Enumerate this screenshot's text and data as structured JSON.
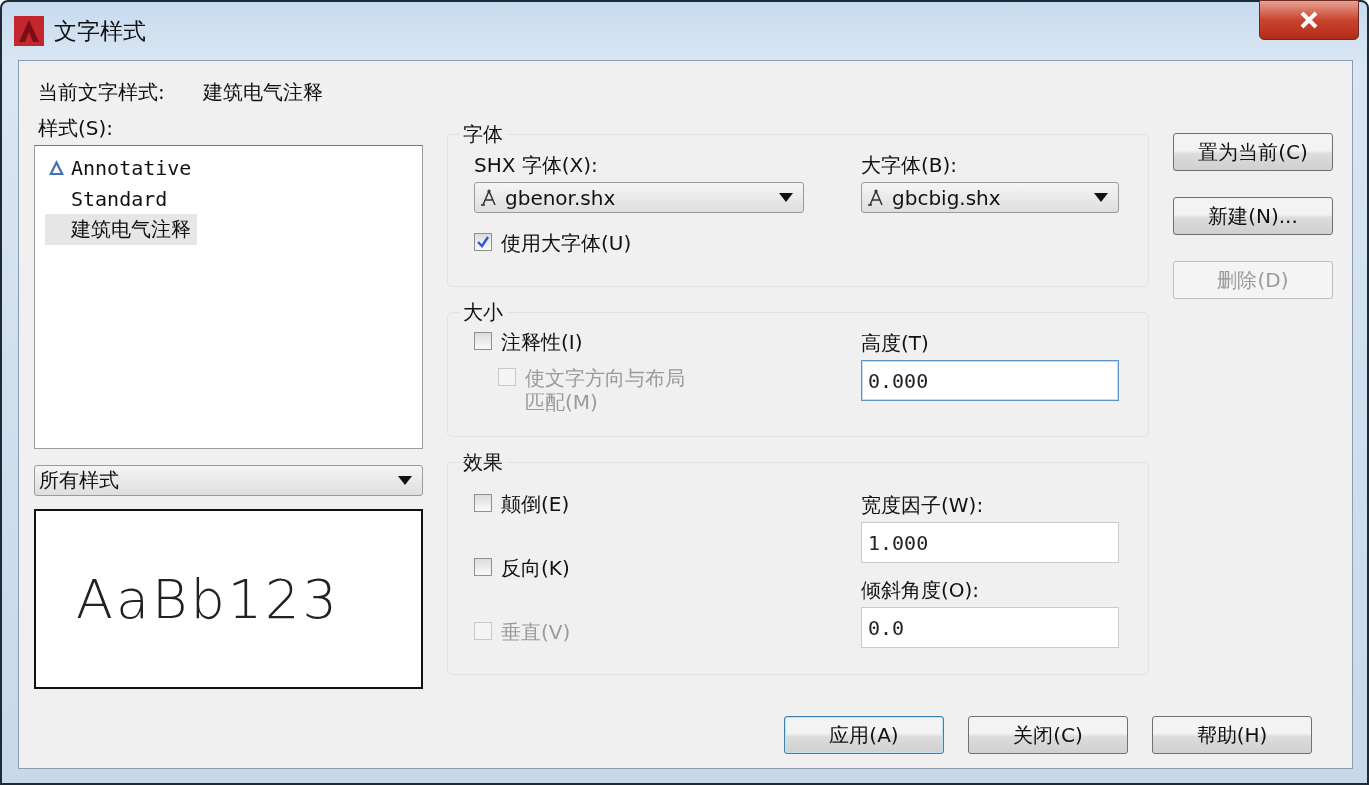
{
  "window": {
    "title": "文字样式"
  },
  "current_style": {
    "label": "当前文字样式:",
    "value": "建筑电气注释"
  },
  "styles": {
    "label": "样式(S):",
    "items": [
      {
        "name": "Annotative",
        "annotative": true,
        "selected": false
      },
      {
        "name": "Standard",
        "annotative": false,
        "selected": false
      },
      {
        "name": "建筑电气注释",
        "annotative": false,
        "selected": true
      }
    ]
  },
  "filter": {
    "value": "所有样式"
  },
  "preview": {
    "text": "AaBb123"
  },
  "font": {
    "legend": "字体",
    "shx_label": "SHX 字体(X):",
    "shx_value": "gbenor.shx",
    "big_label": "大字体(B):",
    "big_value": "gbcbig.shx",
    "use_big": {
      "label": "使用大字体(U)",
      "checked": true,
      "disabled": false
    }
  },
  "size": {
    "legend": "大小",
    "annotative": {
      "label": "注释性(I)",
      "checked": false,
      "disabled": false
    },
    "match_layout": {
      "label": "使文字方向与布局匹配(M)",
      "checked": false,
      "disabled": true
    },
    "height_label": "高度(T)",
    "height": {
      "value": "0.000",
      "focused": true
    }
  },
  "effects": {
    "legend": "效果",
    "checks": [
      {
        "label": "颠倒(E)",
        "checked": false,
        "disabled": false
      },
      {
        "label": "反向(K)",
        "checked": false,
        "disabled": false
      },
      {
        "label": "垂直(V)",
        "checked": false,
        "disabled": true
      }
    ],
    "width_label": "宽度因子(W):",
    "width": {
      "value": "1.000",
      "focused": false
    },
    "oblique_label": "倾斜角度(O):",
    "oblique": {
      "value": "0.0",
      "focused": false
    }
  },
  "side_buttons": [
    {
      "label": "置为当前(C)",
      "disabled": false
    },
    {
      "label": "新建(N)...",
      "disabled": false
    },
    {
      "label": "删除(D)",
      "disabled": true
    }
  ],
  "buttons": [
    {
      "label": "应用(A)",
      "default": true
    },
    {
      "label": "关闭(C)",
      "default": false
    },
    {
      "label": "帮助(H)",
      "default": false
    }
  ]
}
